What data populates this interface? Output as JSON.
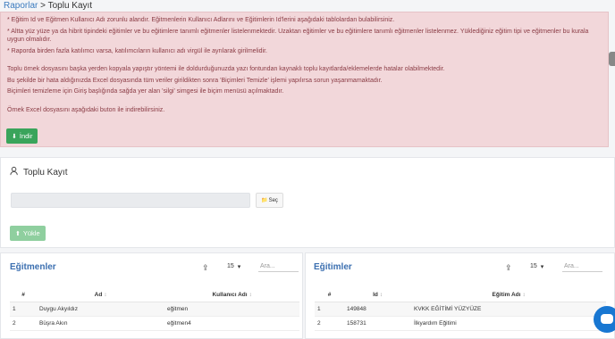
{
  "breadcrumb": {
    "parent": "Raporlar",
    "separator": ">",
    "current": "Toplu Kayıt"
  },
  "alert": {
    "lines": [
      "* Eğitim Id ve Eğitmen Kullanıcı Adı zorunlu alandır. Eğitmenlerin Kullanıcı Adlarını ve Eğitimlerin Id'lerini aşağıdaki tablolardan bulabilirsiniz.",
      "* Altta yüz yüze ya da hibrit tipindeki eğitimler ve bu eğitimlere tanımlı eğitmenler listelenmektedir. Uzaktan eğitimler ve bu eğitimlere tanımlı eğitmenler listelenmez. Yüklediğiniz eğitim tipi ve eğitmenler bu kurala uygun olmalıdır.",
      "* Raporda birden fazla katılımcı varsa, katılımcıların kullanıcı adı virgül ile ayrılarak girilmelidir.",
      "Toplu örnek dosyasını başka yerden kopyala yapıştır yöntemi ile doldurduğunuzda yazı fontundan kaynaklı toplu kayıtlarda/eklemelerde hatalar olabilmektedir.",
      "Bu şekilde bir hata aldığınızda Excel dosyasında tüm veriler girildikten sonra 'Biçimleri Temizle' işlemi yapılırsa sorun yaşanmamaktadır.",
      "Biçimleri temizleme için Giriş başlığında sağda yer alan 'silgi' simgesi ile biçim menüsü açılmaktadır.",
      "Örnek Excel dosyasını aşağıdaki buton ile indirebilirsiniz."
    ],
    "download_label": "İndir"
  },
  "upload": {
    "title": "Toplu Kayıt",
    "select_label": "Seç",
    "upload_label": "Yükle"
  },
  "trainers": {
    "title": "Eğitmenler",
    "page_size": "15",
    "search_placeholder": "Ara...",
    "headers": [
      "#",
      "Ad",
      "Kullanıcı Adı"
    ],
    "rows": [
      [
        "1",
        "Duygu Akyıldız",
        "eğitmen"
      ],
      [
        "2",
        "Büşra Akın",
        "eğitmen4"
      ]
    ]
  },
  "courses": {
    "title": "Eğitimler",
    "page_size": "15",
    "search_placeholder": "Ara...",
    "headers": [
      "#",
      "Id",
      "Eğitim Adı"
    ],
    "rows": [
      [
        "1",
        "149848",
        "KVKK EĞİTİMİ YÜZYÜZE"
      ],
      [
        "2",
        "158731",
        "İlkyardım Eğitimi"
      ]
    ]
  },
  "colors": {
    "alert_bg": "#f2d7da",
    "alert_text": "#8a3b44",
    "button_green": "#3aa45b",
    "title_blue": "#3b6fb0",
    "chat_blue": "#1877d2"
  }
}
